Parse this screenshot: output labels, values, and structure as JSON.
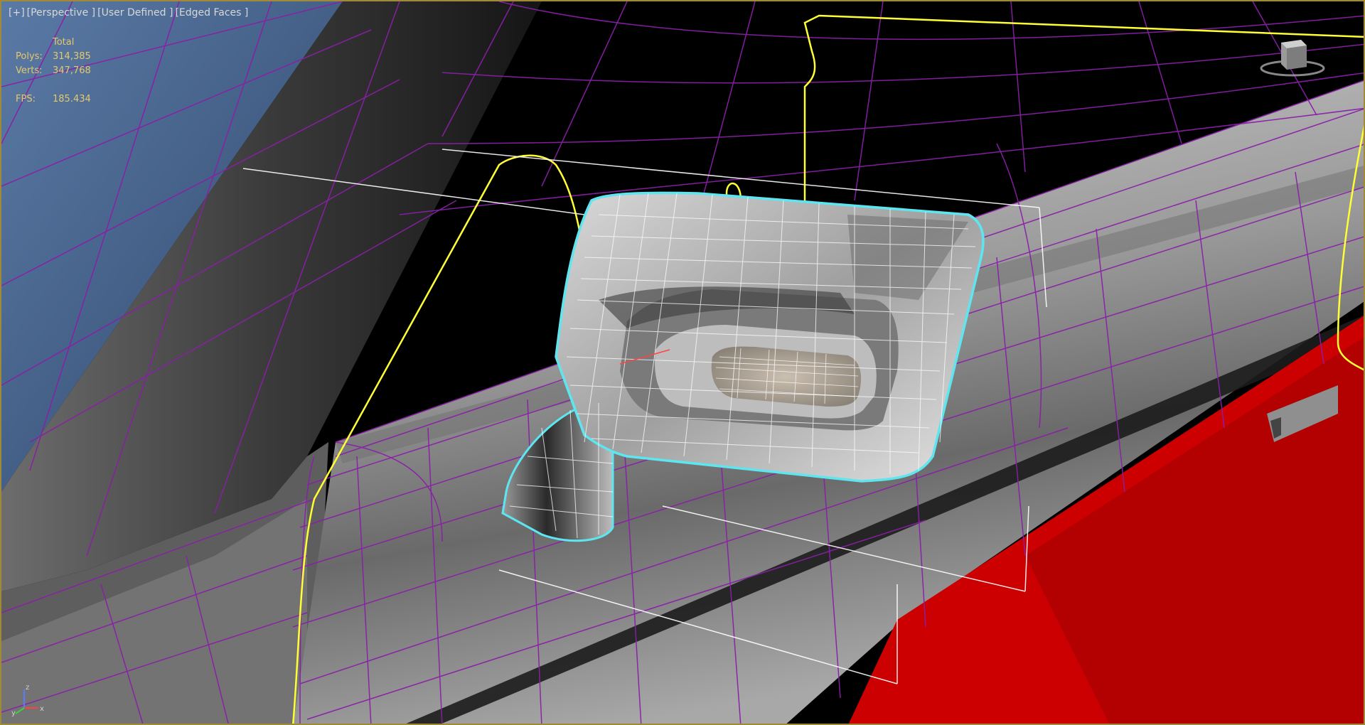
{
  "viewport": {
    "label_plus": "[+]",
    "label_view": "[Perspective ]",
    "label_shading": "[User Defined ]",
    "label_edges": "[Edged Faces ]"
  },
  "stats": {
    "header": "Total",
    "polys_label": "Polys:",
    "polys_value": "314,385",
    "verts_label": "Verts:",
    "verts_value": "347,768",
    "fps_label": "FPS:",
    "fps_value": "185.434"
  },
  "axis": {
    "x": "x",
    "y": "y",
    "z": "z"
  },
  "colors": {
    "wire_purple": "#8a1fa8",
    "selection_cyan": "#5ee6f0",
    "spline_yellow": "#ffff33",
    "door_red": "#cc0000",
    "window_blue": "#4f6f9a",
    "stats_text": "#e6c86a"
  },
  "icons": {
    "viewcube": "viewcube-icon",
    "axis": "axis-tripod-icon"
  }
}
